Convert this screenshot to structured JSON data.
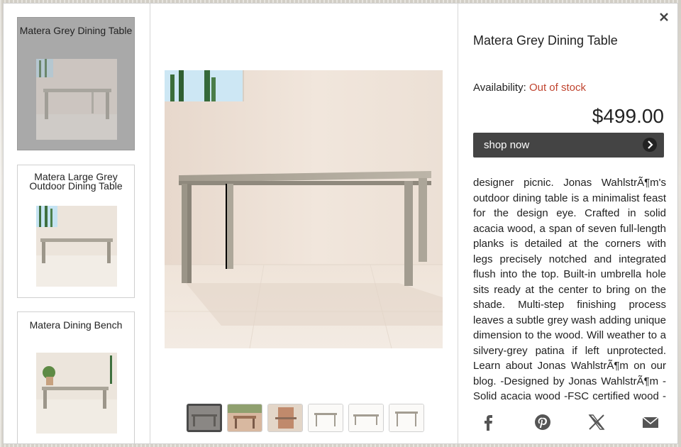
{
  "left_panel": {
    "cards": [
      {
        "title_lines": [
          "Matera Grey Dining Table"
        ],
        "active": true
      },
      {
        "title_lines": [
          "Matera Large Grey",
          "Outdoor Dining Table"
        ],
        "active": false
      },
      {
        "title_lines": [
          "Matera Dining Bench"
        ],
        "active": false
      }
    ]
  },
  "gallery": {
    "thumbnail_count": 6,
    "selected_index": 0
  },
  "product": {
    "title": "Matera Grey Dining Table",
    "availability_label": "Availability:",
    "availability_status": "Out of stock",
    "price": "$499.00",
    "shop_button_label": "shop now",
    "description": " designer picnic.  Jonas WahlstrÃ¶m's outdoor dining table is a minimalist feast for the design eye. Crafted in solid acacia wood, a span of seven full-length planks is detailed at the corners with legs precisely notched and integrated flush into the top. Built-in umbrella hole sits ready at the center to bring on the shade. Multi-step finishing process leaves a subtle grey wash adding unique dimension to the wood. Will weather to a silvery-grey patina if left unprotected. Learn about Jonas WahlstrÃ¶m on our blog. -Designed by Jonas WahlstrÃ¶m -Solid acacia wood -FSC certified wood -Due to the hand-applied nature of the finish, the"
  },
  "share": {
    "icons": [
      "facebook-icon",
      "pinterest-icon",
      "x-twitter-icon",
      "email-icon"
    ]
  },
  "colors": {
    "out_of_stock": "#c0442f",
    "button_bg": "#444444",
    "active_card": "#a9a9a9"
  }
}
